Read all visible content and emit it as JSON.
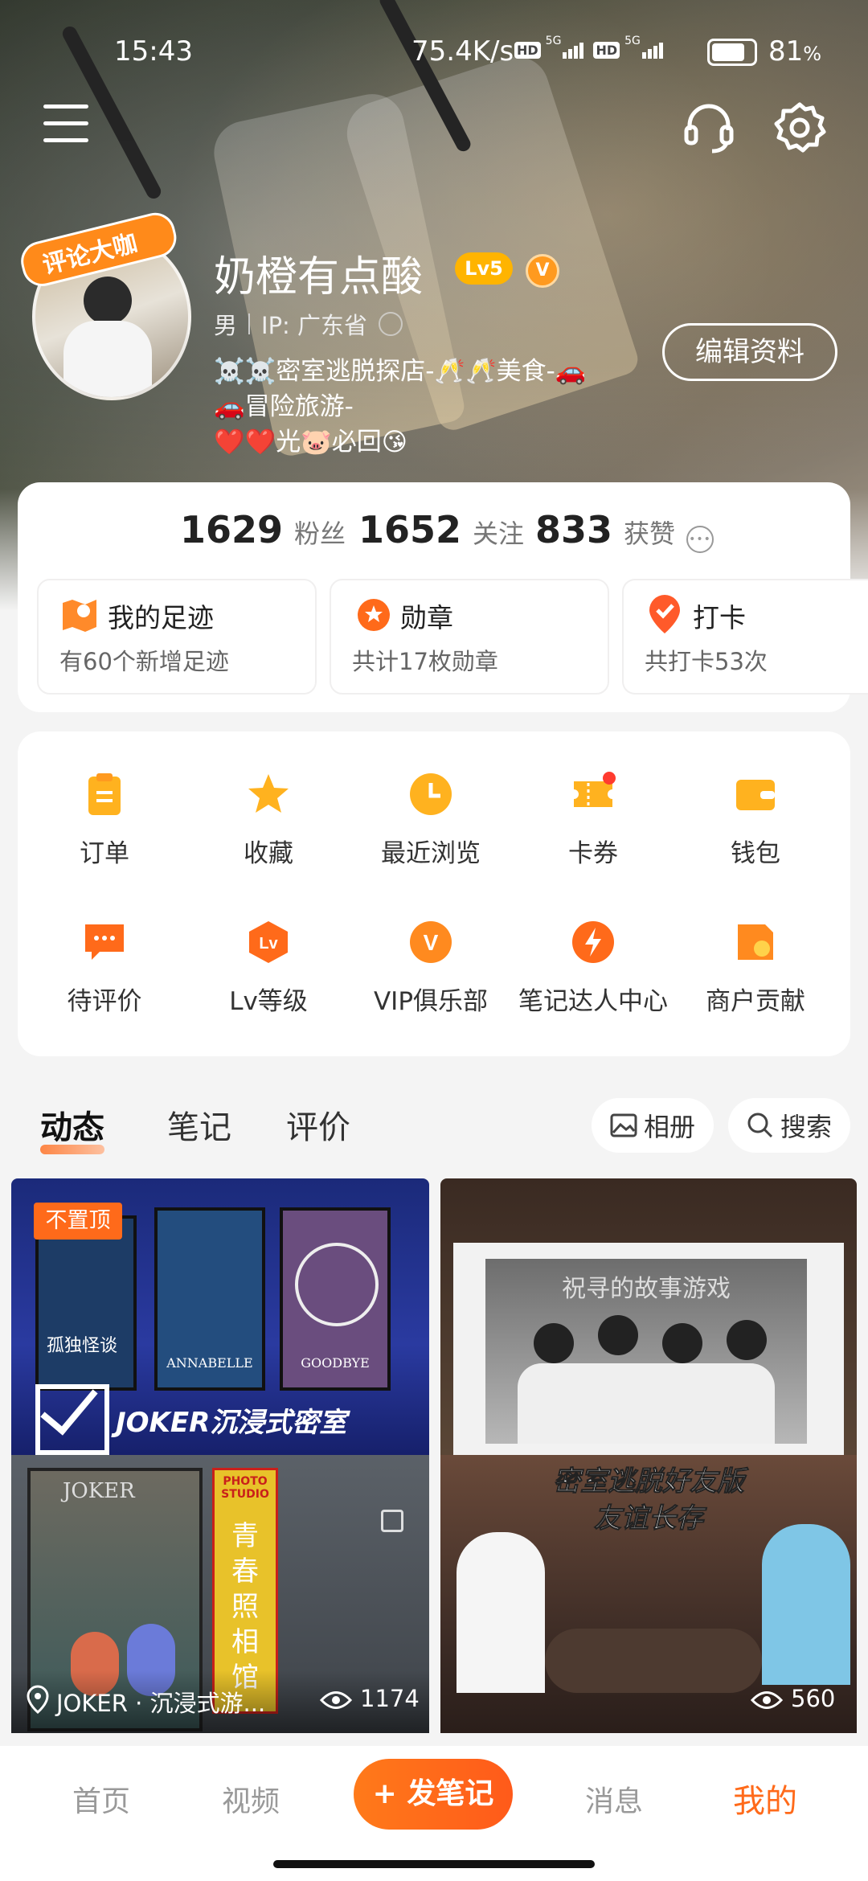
{
  "status_bar": {
    "time": "15:43",
    "network_speed": "75.4K/s",
    "hd1": "HD",
    "sig1": "5G",
    "hd2": "HD",
    "sig2": "5G",
    "battery": "81"
  },
  "profile": {
    "avatar_badge": "评论大咖",
    "username": "奶橙有点酸",
    "level_badge": "Lv5",
    "vip_badge": "V",
    "gender": "男",
    "ip": "IP: 广东省",
    "bio_line1": "☠️☠️密室逃脱探店-🥂🥂美食-🚗",
    "bio_line2": "🚗冒险旅游-",
    "bio_line3": "❤️❤️光🐷必回😘",
    "edit_button": "编辑资料"
  },
  "stats": {
    "fans_num": "1629",
    "fans_label": "粉丝",
    "follow_num": "1652",
    "follow_label": "关注",
    "likes_num": "833",
    "likes_label": "获赞"
  },
  "quick_cards": [
    {
      "title": "我的足迹",
      "sub": "有60个新增足迹"
    },
    {
      "title": "勋章",
      "sub": "共计17枚勋章"
    },
    {
      "title": "打卡",
      "sub": "共打卡53次"
    }
  ],
  "menu": [
    {
      "label": "订单",
      "icon": "clipboard-icon"
    },
    {
      "label": "收藏",
      "icon": "star-icon"
    },
    {
      "label": "最近浏览",
      "icon": "clock-icon"
    },
    {
      "label": "卡券",
      "icon": "ticket-icon"
    },
    {
      "label": "钱包",
      "icon": "wallet-icon"
    },
    {
      "label": "待评价",
      "icon": "comment-icon"
    },
    {
      "label": "Lv等级",
      "icon": "level-icon"
    },
    {
      "label": "VIP俱乐部",
      "icon": "vip-icon"
    },
    {
      "label": "笔记达人中心",
      "icon": "lightning-icon"
    },
    {
      "label": "商户贡献",
      "icon": "shop-icon"
    }
  ],
  "menu_icon_glyphs": {
    "lv": "Lv",
    "v": "V"
  },
  "content_tabs": {
    "tab1": "动态",
    "tab2": "笔记",
    "tab3": "评价",
    "album": "相册",
    "search": "搜索"
  },
  "feed": {
    "pin_label": "不置顶",
    "post1_overlay": "JOKER沉浸式密室",
    "post1_posters": [
      "孤独怪谈",
      "ANNABELLE",
      "GOODBYE"
    ],
    "post1_shop_sign": "JOKER",
    "post1_studio": "PHOTO STUDIO",
    "post1_studio_cn": "青春照相馆",
    "post1_location": "JOKER · 沉浸式游...",
    "post1_views": "1174",
    "post2_photo_caption": "祝寻的故事游戏",
    "post2_overlay_line1": "密室逃脱好友版",
    "post2_overlay_line2": "友谊长存",
    "post2_views": "560"
  },
  "bottom_nav": {
    "home": "首页",
    "video": "视频",
    "post": "+ 发笔记",
    "messages": "消息",
    "mine": "我的"
  },
  "colors": {
    "accent": "#ff6a1a",
    "orange_icon": "#ff9a1f",
    "text": "#222222"
  }
}
